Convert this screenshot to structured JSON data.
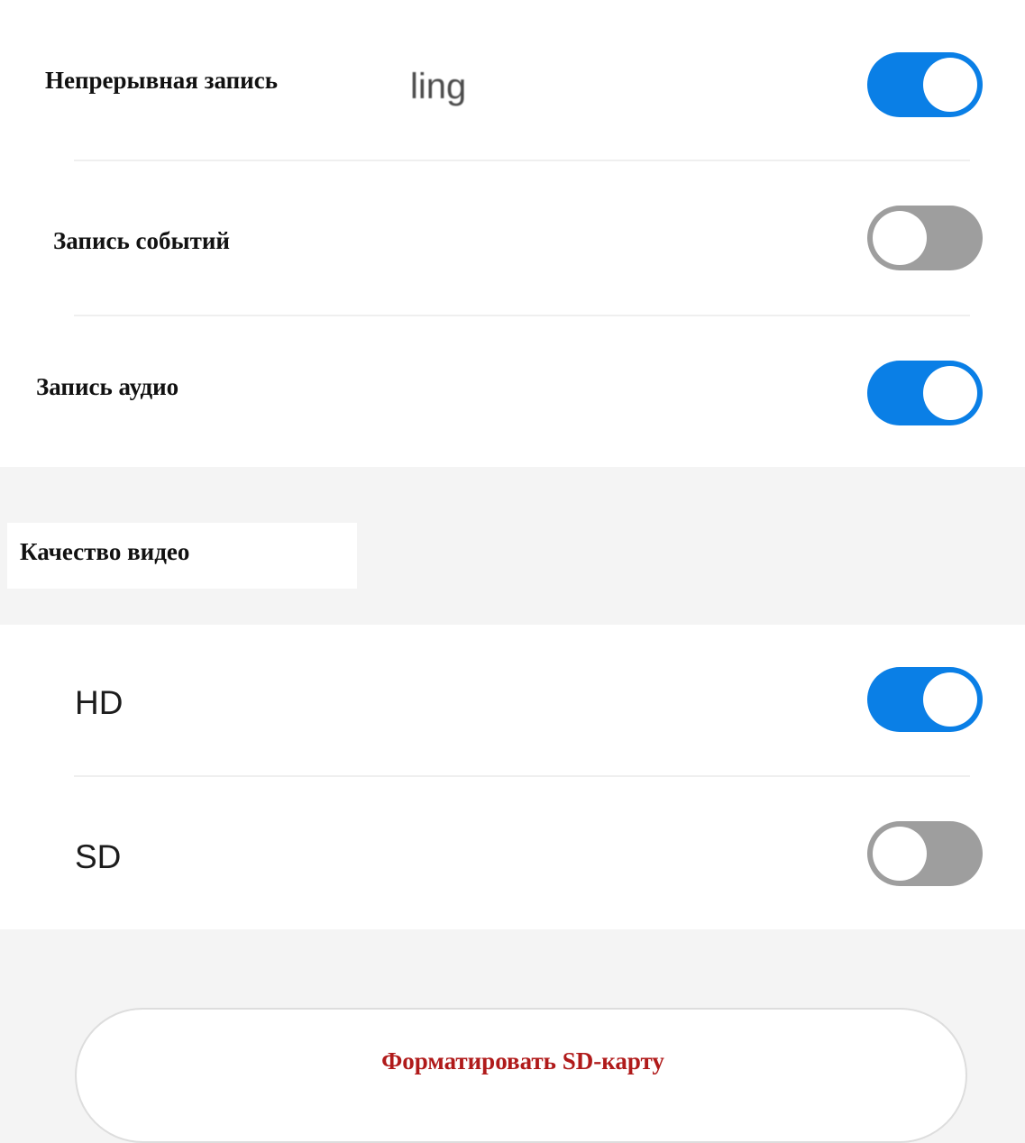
{
  "recording": {
    "continuous": {
      "label": "Непрерывная запись",
      "ghost_text": "ling",
      "enabled": true
    },
    "events": {
      "label": "Запись событий",
      "enabled": false
    },
    "audio": {
      "label": "Запись аудио",
      "enabled": true
    }
  },
  "video_quality": {
    "header": "Качество видео",
    "options": [
      {
        "label": "HD",
        "selected": true
      },
      {
        "label": "SD",
        "selected": false
      }
    ]
  },
  "format_button": {
    "label": "Форматировать SD-карту"
  },
  "colors": {
    "toggle_on": "#0a7fe6",
    "toggle_off": "#9e9e9e",
    "format_text": "#b01a1a"
  }
}
